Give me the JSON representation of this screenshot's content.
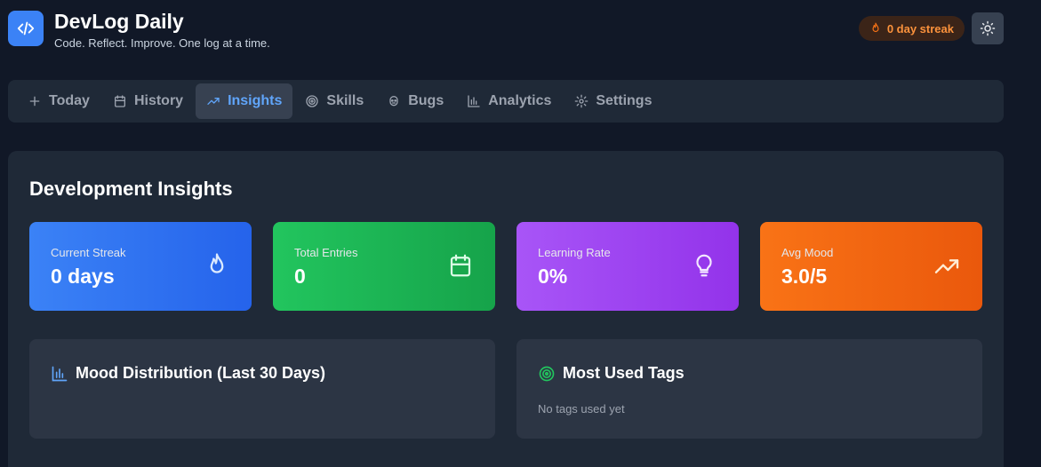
{
  "app": {
    "title": "DevLog Daily",
    "subtitle": "Code. Reflect. Improve. One log at a time.",
    "streak_badge": "0 day streak"
  },
  "nav": {
    "tabs": [
      {
        "label": "Today",
        "icon": "plus-icon"
      },
      {
        "label": "History",
        "icon": "calendar-icon"
      },
      {
        "label": "Insights",
        "icon": "trending-up-icon",
        "active": true
      },
      {
        "label": "Skills",
        "icon": "target-icon"
      },
      {
        "label": "Bugs",
        "icon": "bug-icon"
      },
      {
        "label": "Analytics",
        "icon": "bar-chart-icon"
      },
      {
        "label": "Settings",
        "icon": "gear-icon"
      }
    ]
  },
  "insights": {
    "title": "Development Insights",
    "stats": [
      {
        "label": "Current Streak",
        "value": "0 days",
        "icon": "flame-icon",
        "color": "#3b82f6"
      },
      {
        "label": "Total Entries",
        "value": "0",
        "icon": "calendar-icon",
        "color": "#22c55e"
      },
      {
        "label": "Learning Rate",
        "value": "0%",
        "icon": "lightbulb-icon",
        "color": "#a855f7"
      },
      {
        "label": "Avg Mood",
        "value": "3.0/5",
        "icon": "trending-up-icon",
        "color": "#f97316"
      }
    ],
    "mood_card": {
      "title": "Mood Distribution (Last 30 Days)",
      "icon": "bar-chart-icon"
    },
    "tags_card": {
      "title": "Most Used Tags",
      "icon": "target-icon",
      "empty": "No tags used yet"
    }
  },
  "colors": {
    "background": "#111827",
    "surface": "#1f2937",
    "accent": "#3b82f6",
    "streak": "#fb923c"
  }
}
